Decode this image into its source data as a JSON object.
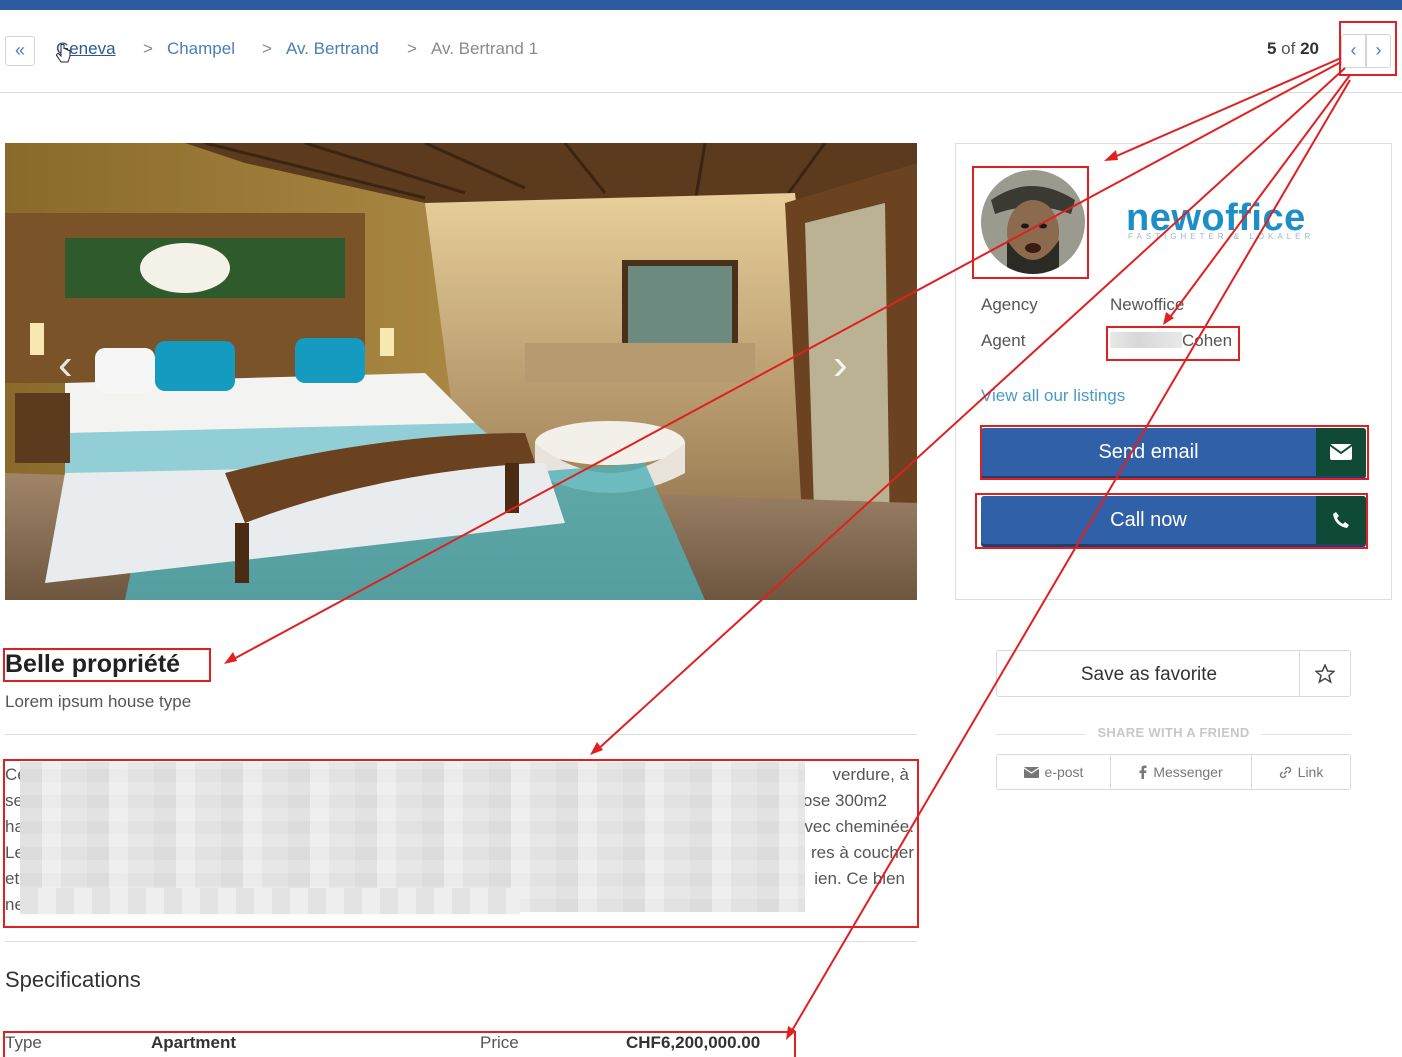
{
  "breadcrumb": {
    "back_label": "«",
    "items": [
      {
        "label": "Geneva",
        "sep": ""
      },
      {
        "label": "Champel",
        "sep": ">"
      },
      {
        "label": "Av. Bertrand",
        "sep": ">"
      },
      {
        "label": "Av. Bertrand 1",
        "sep": ">"
      }
    ]
  },
  "pager": {
    "current": "5",
    "of": "of",
    "total": "20",
    "prev": "‹",
    "next": "›"
  },
  "photo": {
    "prev": "‹",
    "next": "›"
  },
  "agent_card": {
    "logo_word": "newoffice",
    "logo_sub": "FASTIGHETER & LOKALER",
    "agency_label": "Agency",
    "agency_value": "Newoffice",
    "agent_label": "Agent",
    "agent_value_visible": "Cohen",
    "view_all": "View all our listings",
    "send_email": "Send email",
    "call_now": "Call now"
  },
  "favorite": {
    "label": "Save as favorite"
  },
  "share": {
    "title": "SHARE WITH A FRIEND",
    "items": [
      {
        "label": "e-post",
        "icon": "envelope-icon"
      },
      {
        "label": "Messenger",
        "icon": "facebook-icon"
      },
      {
        "label": "Link",
        "icon": "link-icon"
      }
    ]
  },
  "listing": {
    "title": "Belle propriété",
    "subtitle": "Lorem ipsum house type",
    "description_lines": [
      {
        "start": "Ce",
        "end": "verdure, à"
      },
      {
        "start": "se",
        "end": "ose 300m2"
      },
      {
        "start": "ha",
        "end": "vec cheminée."
      },
      {
        "start": "Le",
        "end": "res à coucher"
      },
      {
        "start": "et",
        "end": "ien.   Ce bien"
      },
      {
        "start": "ne",
        "end": ""
      }
    ]
  },
  "specifications": {
    "title": "Specifications",
    "rows": [
      {
        "label1": "Type",
        "value1": "Apartment",
        "label2": "Price",
        "value2": "CHF6,200,000.00"
      }
    ]
  },
  "colors": {
    "brand_blue": "#3060a8",
    "icon_green": "#0e4a36",
    "link_blue": "#4a7db8",
    "annotation_red": "#e02020"
  }
}
